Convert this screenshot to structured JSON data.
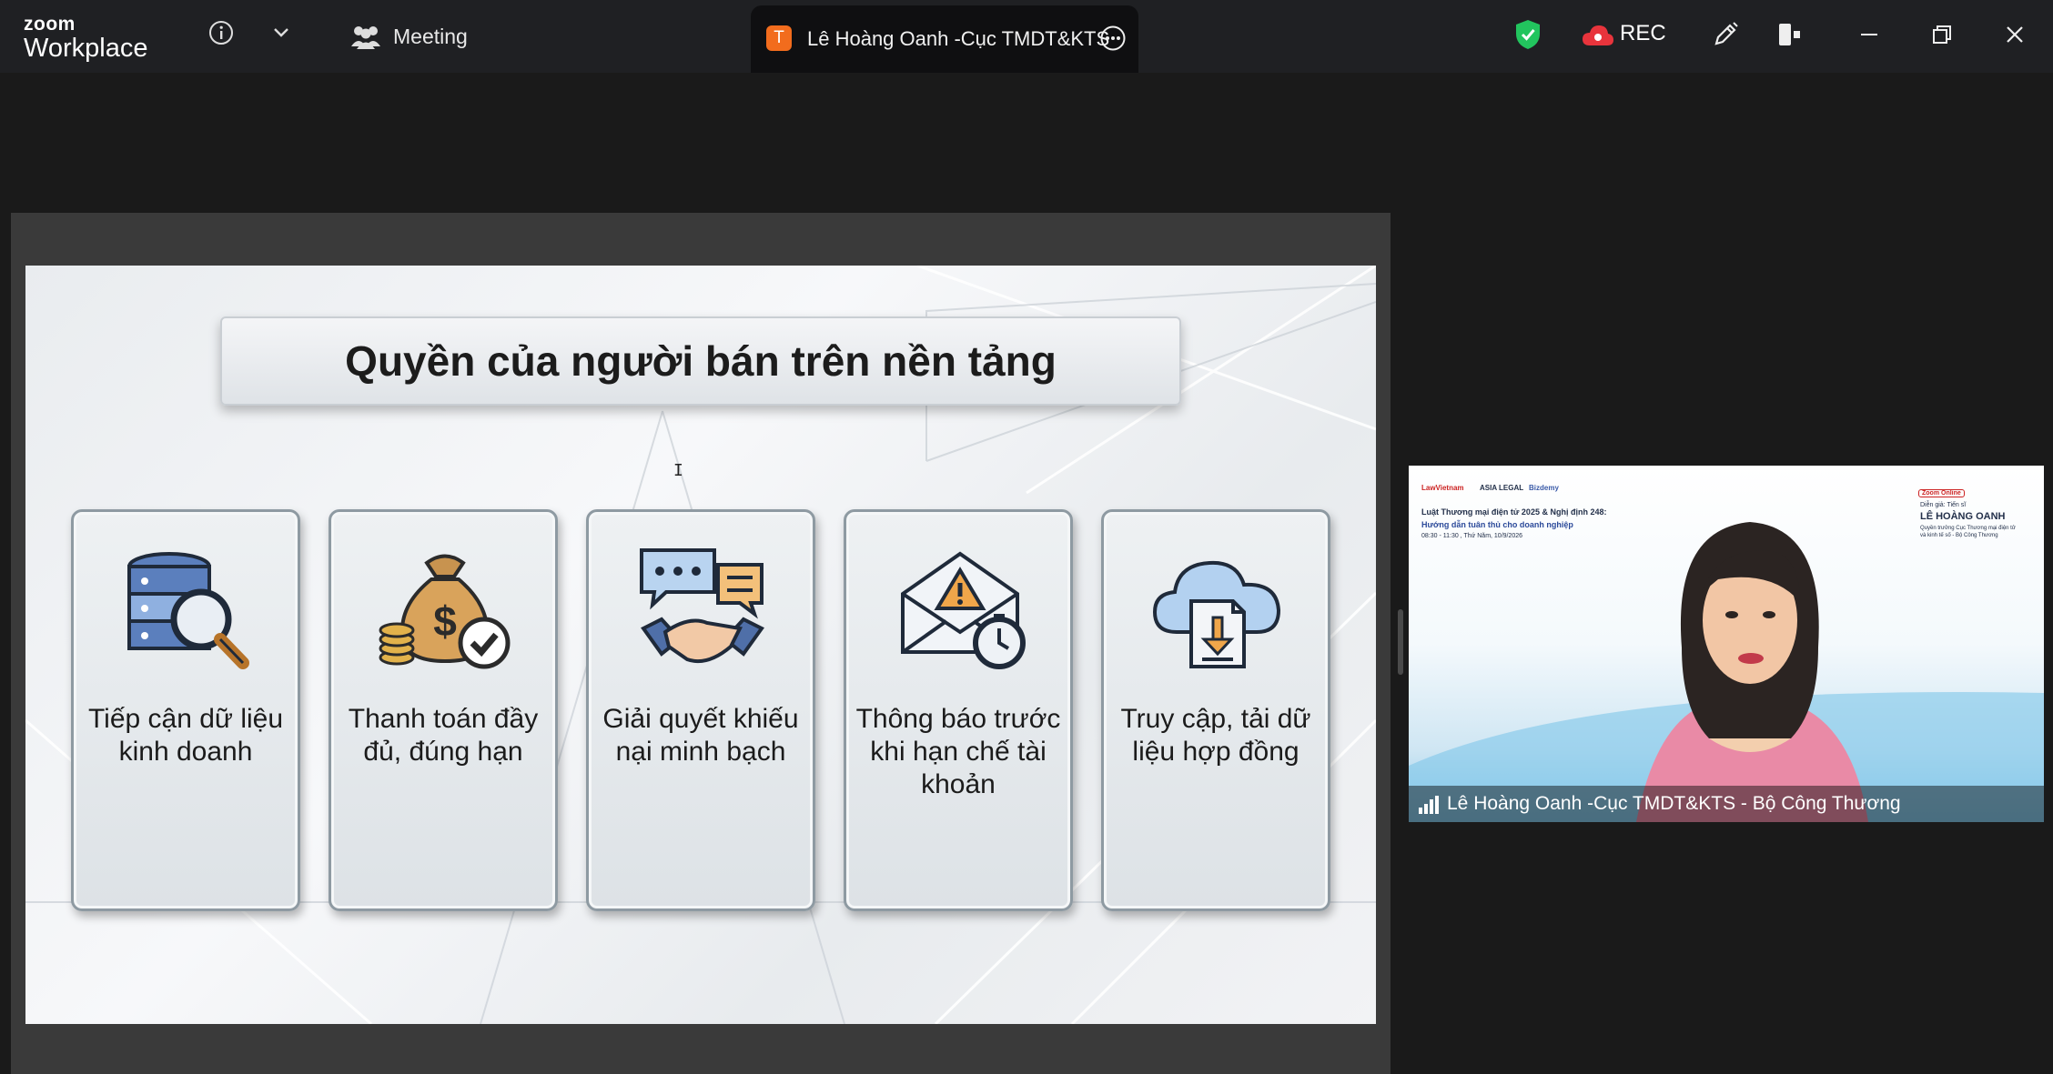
{
  "titlebar": {
    "brand_top": "zoom",
    "brand_bottom": "Workplace",
    "meeting_label": "Meeting",
    "tab_avatar": "T",
    "tab_title": "Lê Hoàng Oanh -Cục TMDT&KTS",
    "rec_label": "REC",
    "accent_shield": "#22c55e",
    "avatar_color": "#f26c1d"
  },
  "slide": {
    "title": "Quyền của người bán trên nền tảng",
    "cards": [
      {
        "icon": "database-search-icon",
        "label": "Tiếp cận dữ liệu kinh doanh"
      },
      {
        "icon": "money-bag-check-icon",
        "label": "Thanh toán đầy đủ, đúng hạn"
      },
      {
        "icon": "chat-handshake-icon",
        "label": "Giải quyết khiếu nại minh bạch"
      },
      {
        "icon": "mail-warning-clock-icon",
        "label": "Thông báo trước khi hạn chế tài khoản"
      },
      {
        "icon": "cloud-download-icon",
        "label": "Truy cập, tải dữ liệu hợp đồng"
      }
    ]
  },
  "video": {
    "banner_brands": [
      "LawVietnam",
      "ASIA LEGAL",
      "Bizdemy"
    ],
    "banner_line1": "Luật Thương mại điện tử 2025 & Nghị định 248:",
    "banner_line2": "Hướng dẫn tuân thủ cho doanh nghiệp",
    "banner_time": "08:30 - 11:30 , Thứ Năm, 10/9/2026",
    "badge": "Zoom Online",
    "speaker_role": "Diễn giả: Tiến sĩ",
    "speaker_name": "LÊ HOÀNG OANH",
    "speaker_title_1": "Quyền trưởng Cục Thương mại điện tử",
    "speaker_title_2": "và kinh tế số - Bộ Công Thương",
    "participant_name": "Lê Hoàng Oanh -Cục TMDT&KTS - Bộ Công Thương"
  }
}
